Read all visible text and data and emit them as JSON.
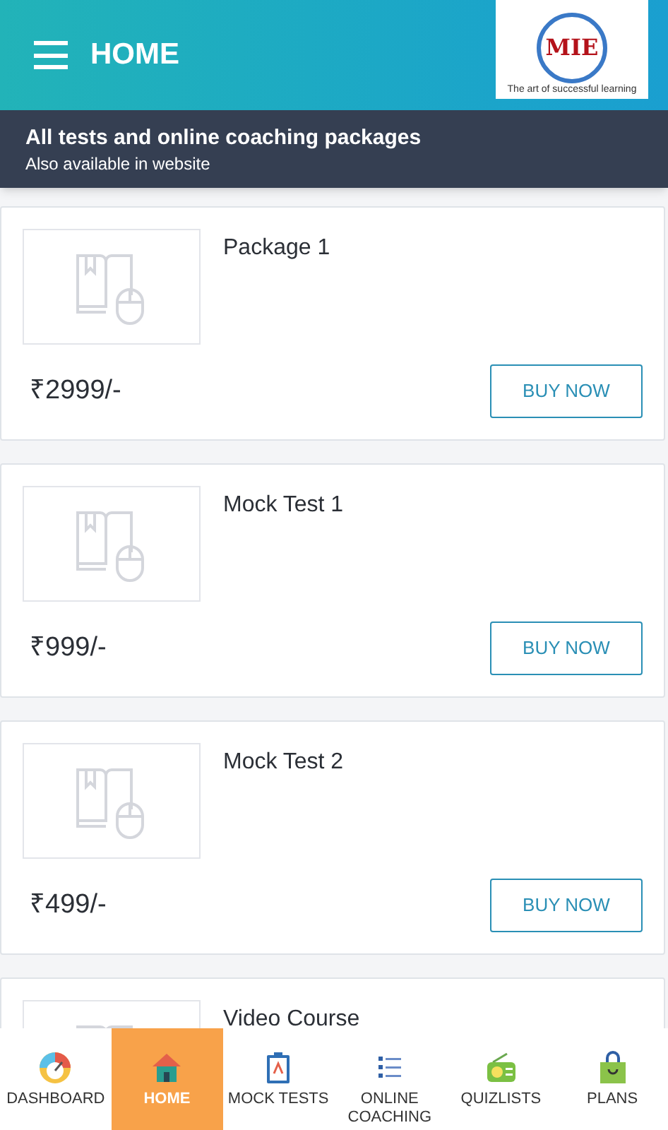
{
  "header": {
    "title": "HOME",
    "logo": {
      "mark": "MIE",
      "tagline": "The art of successful learning"
    }
  },
  "banner": {
    "title": "All tests and online coaching packages",
    "subtitle": "Also available in website"
  },
  "packages": [
    {
      "name": "Package 1",
      "price": "₹2999/-",
      "button": "BUY NOW"
    },
    {
      "name": "Mock Test 1",
      "price": "₹999/-",
      "button": "BUY NOW"
    },
    {
      "name": "Mock Test 2",
      "price": "₹499/-",
      "button": "BUY NOW"
    },
    {
      "name": "Video Course"
    }
  ],
  "nav": [
    {
      "kind": "dashboard",
      "label": "DASHBOARD",
      "selected": false
    },
    {
      "kind": "home",
      "label": "HOME",
      "selected": true
    },
    {
      "kind": "mock",
      "label": "MOCK TESTS",
      "selected": false
    },
    {
      "kind": "coaching",
      "label": "ONLINE COACHING",
      "selected": false
    },
    {
      "kind": "quiz",
      "label": "QUIZLISTS",
      "selected": false
    },
    {
      "kind": "plans",
      "label": "PLANS",
      "selected": false
    }
  ]
}
